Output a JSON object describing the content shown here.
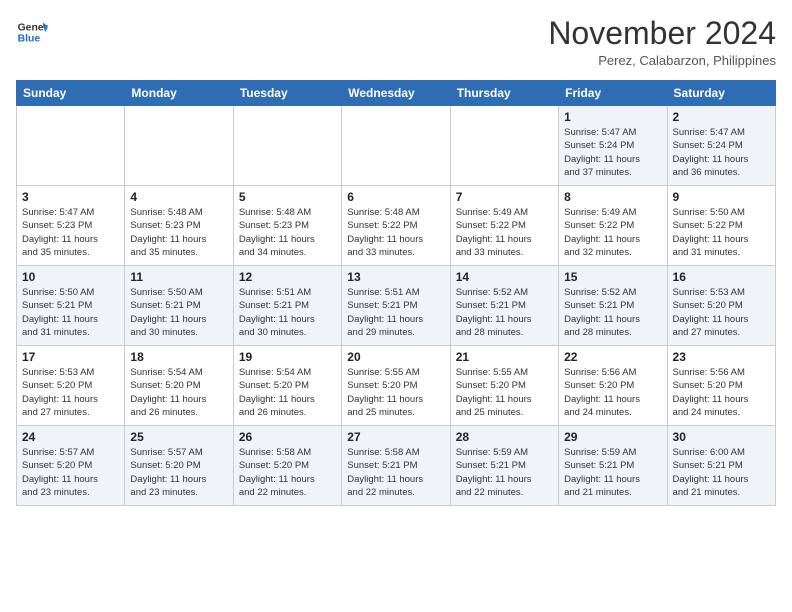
{
  "logo": {
    "line1": "General",
    "line2": "Blue"
  },
  "header": {
    "month": "November 2024",
    "location": "Perez, Calabarzon, Philippines"
  },
  "weekdays": [
    "Sunday",
    "Monday",
    "Tuesday",
    "Wednesday",
    "Thursday",
    "Friday",
    "Saturday"
  ],
  "weeks": [
    [
      {
        "day": "",
        "info": ""
      },
      {
        "day": "",
        "info": ""
      },
      {
        "day": "",
        "info": ""
      },
      {
        "day": "",
        "info": ""
      },
      {
        "day": "",
        "info": ""
      },
      {
        "day": "1",
        "info": "Sunrise: 5:47 AM\nSunset: 5:24 PM\nDaylight: 11 hours\nand 37 minutes."
      },
      {
        "day": "2",
        "info": "Sunrise: 5:47 AM\nSunset: 5:24 PM\nDaylight: 11 hours\nand 36 minutes."
      }
    ],
    [
      {
        "day": "3",
        "info": "Sunrise: 5:47 AM\nSunset: 5:23 PM\nDaylight: 11 hours\nand 35 minutes."
      },
      {
        "day": "4",
        "info": "Sunrise: 5:48 AM\nSunset: 5:23 PM\nDaylight: 11 hours\nand 35 minutes."
      },
      {
        "day": "5",
        "info": "Sunrise: 5:48 AM\nSunset: 5:23 PM\nDaylight: 11 hours\nand 34 minutes."
      },
      {
        "day": "6",
        "info": "Sunrise: 5:48 AM\nSunset: 5:22 PM\nDaylight: 11 hours\nand 33 minutes."
      },
      {
        "day": "7",
        "info": "Sunrise: 5:49 AM\nSunset: 5:22 PM\nDaylight: 11 hours\nand 33 minutes."
      },
      {
        "day": "8",
        "info": "Sunrise: 5:49 AM\nSunset: 5:22 PM\nDaylight: 11 hours\nand 32 minutes."
      },
      {
        "day": "9",
        "info": "Sunrise: 5:50 AM\nSunset: 5:22 PM\nDaylight: 11 hours\nand 31 minutes."
      }
    ],
    [
      {
        "day": "10",
        "info": "Sunrise: 5:50 AM\nSunset: 5:21 PM\nDaylight: 11 hours\nand 31 minutes."
      },
      {
        "day": "11",
        "info": "Sunrise: 5:50 AM\nSunset: 5:21 PM\nDaylight: 11 hours\nand 30 minutes."
      },
      {
        "day": "12",
        "info": "Sunrise: 5:51 AM\nSunset: 5:21 PM\nDaylight: 11 hours\nand 30 minutes."
      },
      {
        "day": "13",
        "info": "Sunrise: 5:51 AM\nSunset: 5:21 PM\nDaylight: 11 hours\nand 29 minutes."
      },
      {
        "day": "14",
        "info": "Sunrise: 5:52 AM\nSunset: 5:21 PM\nDaylight: 11 hours\nand 28 minutes."
      },
      {
        "day": "15",
        "info": "Sunrise: 5:52 AM\nSunset: 5:21 PM\nDaylight: 11 hours\nand 28 minutes."
      },
      {
        "day": "16",
        "info": "Sunrise: 5:53 AM\nSunset: 5:20 PM\nDaylight: 11 hours\nand 27 minutes."
      }
    ],
    [
      {
        "day": "17",
        "info": "Sunrise: 5:53 AM\nSunset: 5:20 PM\nDaylight: 11 hours\nand 27 minutes."
      },
      {
        "day": "18",
        "info": "Sunrise: 5:54 AM\nSunset: 5:20 PM\nDaylight: 11 hours\nand 26 minutes."
      },
      {
        "day": "19",
        "info": "Sunrise: 5:54 AM\nSunset: 5:20 PM\nDaylight: 11 hours\nand 26 minutes."
      },
      {
        "day": "20",
        "info": "Sunrise: 5:55 AM\nSunset: 5:20 PM\nDaylight: 11 hours\nand 25 minutes."
      },
      {
        "day": "21",
        "info": "Sunrise: 5:55 AM\nSunset: 5:20 PM\nDaylight: 11 hours\nand 25 minutes."
      },
      {
        "day": "22",
        "info": "Sunrise: 5:56 AM\nSunset: 5:20 PM\nDaylight: 11 hours\nand 24 minutes."
      },
      {
        "day": "23",
        "info": "Sunrise: 5:56 AM\nSunset: 5:20 PM\nDaylight: 11 hours\nand 24 minutes."
      }
    ],
    [
      {
        "day": "24",
        "info": "Sunrise: 5:57 AM\nSunset: 5:20 PM\nDaylight: 11 hours\nand 23 minutes."
      },
      {
        "day": "25",
        "info": "Sunrise: 5:57 AM\nSunset: 5:20 PM\nDaylight: 11 hours\nand 23 minutes."
      },
      {
        "day": "26",
        "info": "Sunrise: 5:58 AM\nSunset: 5:20 PM\nDaylight: 11 hours\nand 22 minutes."
      },
      {
        "day": "27",
        "info": "Sunrise: 5:58 AM\nSunset: 5:21 PM\nDaylight: 11 hours\nand 22 minutes."
      },
      {
        "day": "28",
        "info": "Sunrise: 5:59 AM\nSunset: 5:21 PM\nDaylight: 11 hours\nand 22 minutes."
      },
      {
        "day": "29",
        "info": "Sunrise: 5:59 AM\nSunset: 5:21 PM\nDaylight: 11 hours\nand 21 minutes."
      },
      {
        "day": "30",
        "info": "Sunrise: 6:00 AM\nSunset: 5:21 PM\nDaylight: 11 hours\nand 21 minutes."
      }
    ]
  ]
}
